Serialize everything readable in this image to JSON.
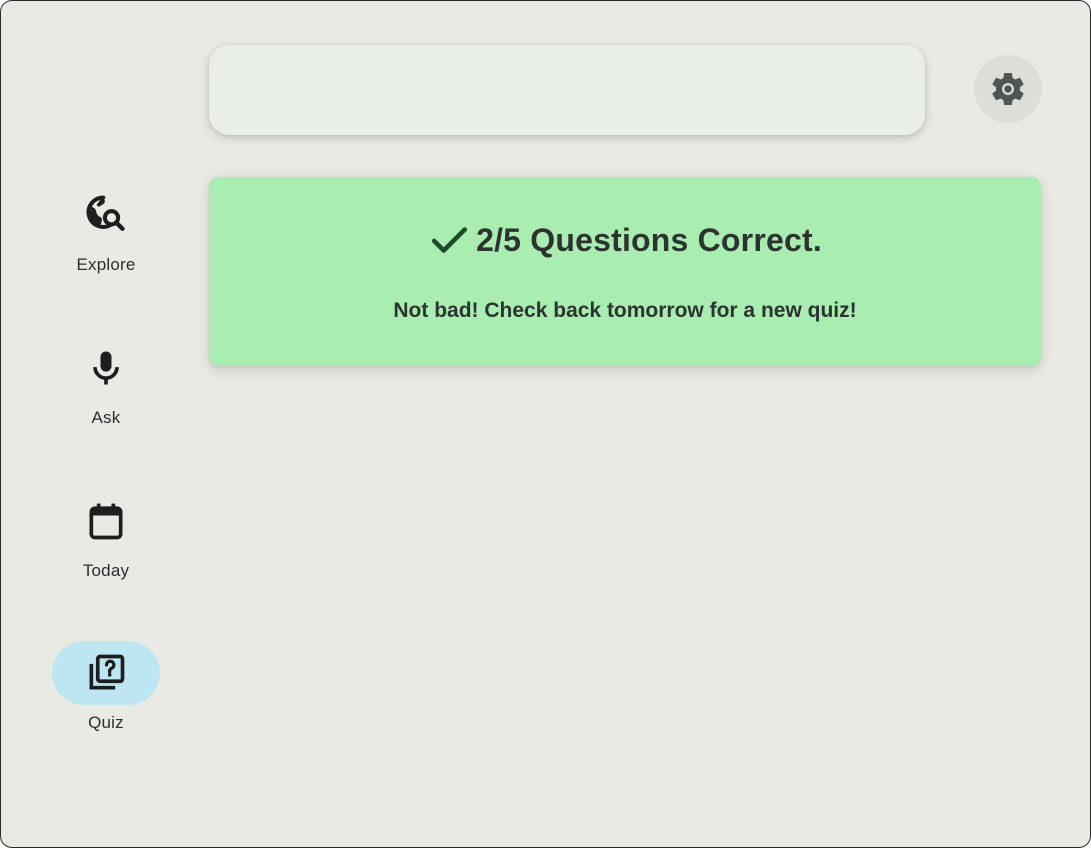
{
  "search": {
    "value": "",
    "placeholder": ""
  },
  "settings": {
    "icon": "gear-icon"
  },
  "nav": {
    "items": [
      {
        "label": "Explore",
        "icon": "globe-search-icon",
        "active": false
      },
      {
        "label": "Ask",
        "icon": "microphone-icon",
        "active": false
      },
      {
        "label": "Today",
        "icon": "calendar-icon",
        "active": false
      },
      {
        "label": "Quiz",
        "icon": "quiz-icon",
        "active": true
      }
    ]
  },
  "result": {
    "icon": "checkmark-icon",
    "title": "2/5 Questions Correct.",
    "message": "Not bad! Check back tomorrow for a new quiz!"
  },
  "colors": {
    "background": "#e8eae3",
    "card": "#a9eeb0",
    "active_nav": "#bde6f2",
    "checkmark": "#1f4a2a"
  }
}
